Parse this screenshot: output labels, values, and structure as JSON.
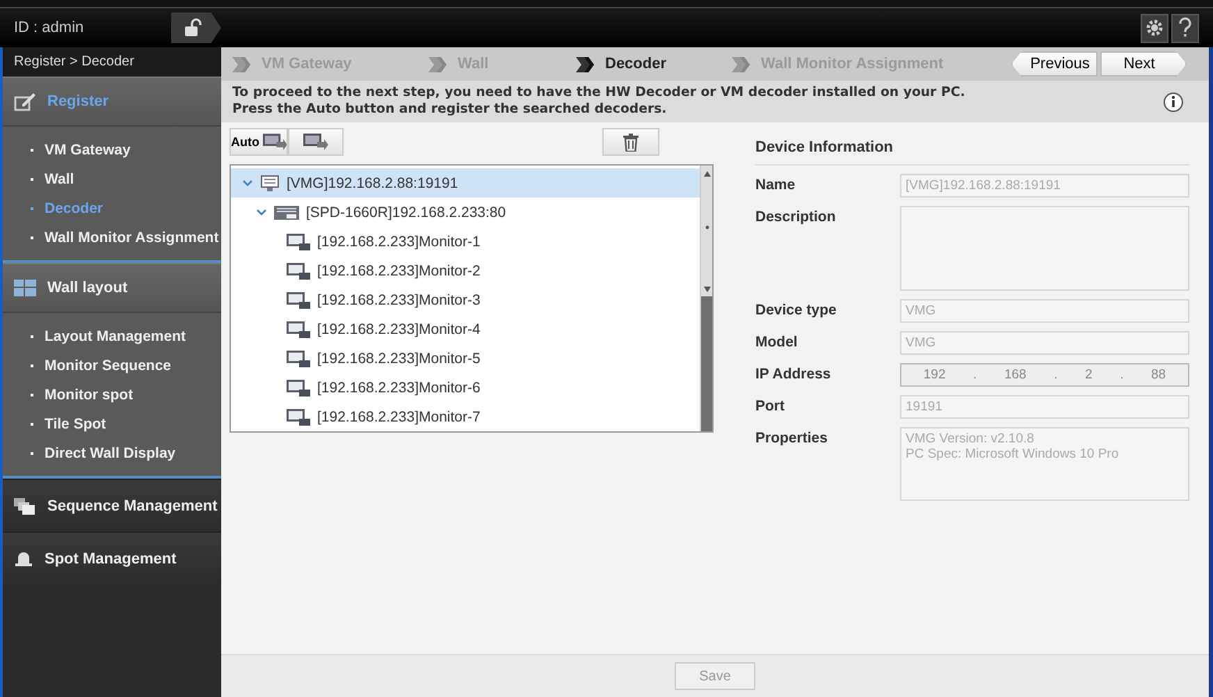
{
  "top_bar": {
    "user": "ID : admin",
    "locked": false
  },
  "breadcrumb": "Register > Decoder",
  "sidebar": {
    "sections": [
      {
        "title": "Register",
        "selected": true,
        "items": [
          {
            "label": "VM Gateway",
            "selected": false
          },
          {
            "label": "Wall",
            "selected": false
          },
          {
            "label": "Decoder",
            "selected": true
          },
          {
            "label": "Wall Monitor Assignment",
            "selected": false
          }
        ]
      },
      {
        "title": "Wall layout",
        "selected": false,
        "items": [
          {
            "label": "Layout Management",
            "selected": false
          },
          {
            "label": "Monitor Sequence",
            "selected": false
          },
          {
            "label": "Monitor spot",
            "selected": false
          },
          {
            "label": "Tile Spot",
            "selected": false
          },
          {
            "label": "Direct Wall Display",
            "selected": false
          }
        ]
      },
      {
        "title": "Sequence Management",
        "selected": false
      },
      {
        "title": "Spot Management",
        "selected": false
      }
    ]
  },
  "steps": [
    {
      "label": "VM Gateway",
      "selected": false
    },
    {
      "label": "Wall",
      "selected": false
    },
    {
      "label": "Decoder",
      "selected": true
    },
    {
      "label": "Wall Monitor Assignment",
      "selected": false
    }
  ],
  "nav_buttons": {
    "previous": "Previous",
    "next": "Next"
  },
  "message": "To proceed to the next step, you need to have the HW Decoder or VM decoder installed on your PC.\nPress the Auto button and register the searched decoders.",
  "toolbar": {
    "auto_label": "Auto"
  },
  "tree": [
    {
      "label": "[VMG]192.168.2.88:19191",
      "kind": "vmg",
      "expanded": true,
      "selected": true,
      "children": [
        {
          "label": "[SPD-1660R]192.168.2.233:80",
          "kind": "decoder",
          "expanded": true,
          "selected": false,
          "children": [
            {
              "label": "[192.168.2.233]Monitor-1",
              "kind": "monitor",
              "selected": false
            },
            {
              "label": "[192.168.2.233]Monitor-2",
              "kind": "monitor",
              "selected": false
            },
            {
              "label": "[192.168.2.233]Monitor-3",
              "kind": "monitor",
              "selected": false
            },
            {
              "label": "[192.168.2.233]Monitor-4",
              "kind": "monitor",
              "selected": false
            },
            {
              "label": "[192.168.2.233]Monitor-5",
              "kind": "monitor",
              "selected": false
            },
            {
              "label": "[192.168.2.233]Monitor-6",
              "kind": "monitor",
              "selected": false
            },
            {
              "label": "[192.168.2.233]Monitor-7",
              "kind": "monitor",
              "selected": false
            }
          ]
        }
      ]
    }
  ],
  "device_info": {
    "title": "Device Information",
    "fields": [
      {
        "label": "Name",
        "kind": "text",
        "value": "[VMG]192.168.2.88:19191"
      },
      {
        "label": "Description",
        "kind": "textarea"
      },
      {
        "label": "Device type",
        "kind": "text",
        "value": "VMG"
      },
      {
        "label": "Model",
        "kind": "text",
        "value": "VMG"
      },
      {
        "label": "IP Address",
        "kind": "ip",
        "parts": [
          "192",
          "168",
          "2",
          "88"
        ],
        "separator": "."
      },
      {
        "label": "Port",
        "kind": "text",
        "value": "19191"
      },
      {
        "label": "Properties",
        "kind": "textarea",
        "value": "VMG Version: v2.10.8\nPC Spec: Microsoft Windows 10 Pro"
      }
    ]
  },
  "save_button": {
    "label": "Save",
    "disabled": true
  }
}
